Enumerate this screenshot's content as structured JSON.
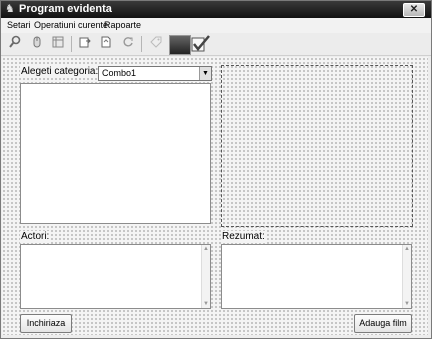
{
  "window": {
    "title": "Program evidenta",
    "close_label": "✕"
  },
  "menu": {
    "items": [
      "Setari",
      "Operatiuni curente",
      "Rapoarte"
    ]
  },
  "toolbar": {
    "icons": [
      "search-icon",
      "mouse-icon",
      "table-icon",
      "export-icon",
      "document-icon",
      "refresh-icon",
      "tag-icon",
      "gradient-icon",
      "checkmark-icon"
    ]
  },
  "form": {
    "category_label": "Alegeti categoria:",
    "category_combo_value": "Combo1",
    "actors_label": "Actori:",
    "summary_label": "Rezumat:",
    "close_button": "Inchiriaza",
    "add_button": "Adauga film"
  }
}
